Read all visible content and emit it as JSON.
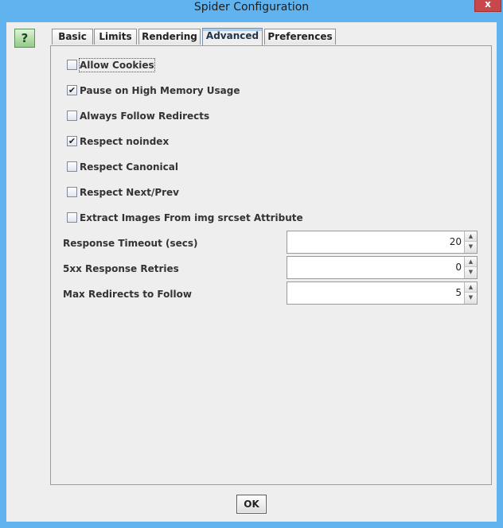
{
  "window": {
    "title": "Spider Configuration",
    "close_glyph": "x"
  },
  "help": {
    "label": "?",
    "icon": "help-icon"
  },
  "tabs": [
    {
      "label": "Basic",
      "active": false
    },
    {
      "label": "Limits",
      "active": false
    },
    {
      "label": "Rendering",
      "active": false
    },
    {
      "label": "Advanced",
      "active": true
    },
    {
      "label": "Preferences",
      "active": false
    }
  ],
  "options": [
    {
      "label": "Allow Cookies",
      "checked": false
    },
    {
      "label": "Pause on High Memory Usage",
      "checked": true
    },
    {
      "label": "Always Follow Redirects",
      "checked": false
    },
    {
      "label": "Respect noindex",
      "checked": true
    },
    {
      "label": "Respect Canonical",
      "checked": false
    },
    {
      "label": "Respect Next/Prev",
      "checked": false
    },
    {
      "label": "Extract Images From img srcset Attribute",
      "checked": false
    }
  ],
  "fields": [
    {
      "label": "Response Timeout (secs)",
      "value": "20"
    },
    {
      "label": "5xx Response Retries",
      "value": "0"
    },
    {
      "label": "Max Redirects to Follow",
      "value": "5"
    }
  ],
  "buttons": {
    "ok": "OK"
  },
  "colors": {
    "title_bar": "#61b3f0",
    "close_button": "#c7474b",
    "help_button": "#93ca86",
    "active_tab_accent": "#aecde8"
  }
}
